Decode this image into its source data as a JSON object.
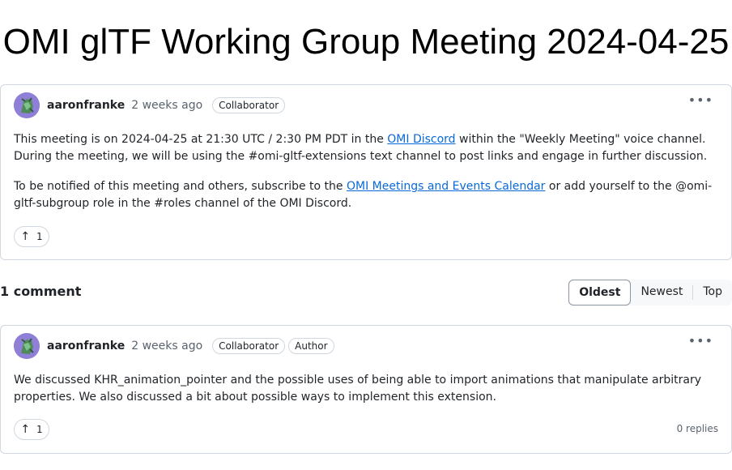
{
  "page": {
    "title": "OMI glTF Working Group Meeting 2024-04-25"
  },
  "post": {
    "author": "aaronfranke",
    "time": "2 weeks ago",
    "badge": "Collaborator",
    "para1_prefix": "This meeting is on 2024-04-25 at 21:30 UTC / 2:30 PM PDT in the ",
    "para1_link": "OMI Discord",
    "para1_suffix": " within the \"Weekly Meeting\" voice channel. During the meeting, we will be using the #omi-gltf-extensions text channel to post links and engage in further discussion.",
    "para2_prefix": "To be notified of this meeting and others, subscribe to the ",
    "para2_link": "OMI Meetings and Events Calendar",
    "para2_suffix": " or add yourself to the @omi-gltf-subgroup role in the #roles channel of the OMI Discord.",
    "upvotes": "1"
  },
  "comments_header": {
    "count_label": "1 comment",
    "sort_options": [
      "Oldest",
      "Newest",
      "Top"
    ],
    "selected_sort": "Oldest"
  },
  "comment": {
    "author": "aaronfranke",
    "time": "2 weeks ago",
    "badge1": "Collaborator",
    "badge2": "Author",
    "body": "We discussed KHR_animation_pointer and the possible uses of being able to import animations that manipulate arbitrary properties. We also discussed a bit about possible ways to implement this extension.",
    "upvotes": "1",
    "replies": "0 replies"
  },
  "icons": {
    "upvote": "arrow-up-icon",
    "menu": "kebab-horizontal-icon"
  },
  "colors": {
    "link": "#0969da",
    "border": "#d0d7de",
    "muted_text": "#59636e",
    "avatar_bg": "#8f7fd6"
  }
}
